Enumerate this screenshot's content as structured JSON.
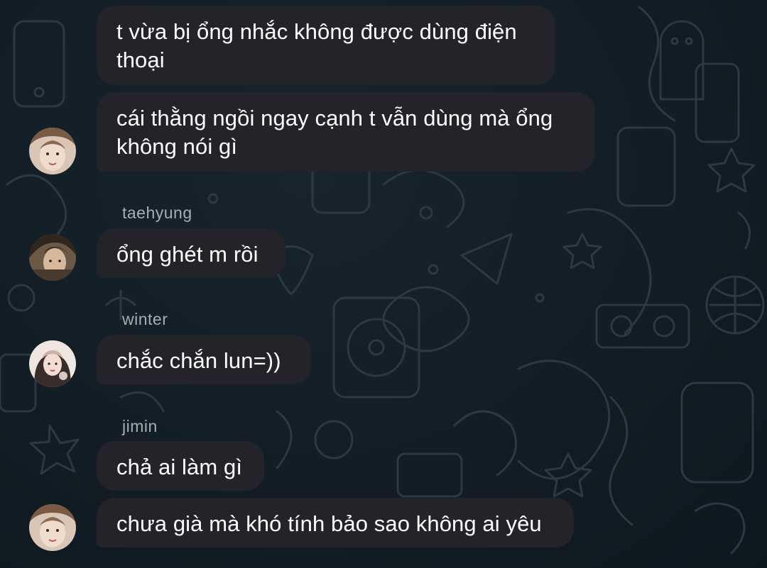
{
  "messages": [
    {
      "text": "t vừa bị ổng nhắc không được dùng điện thoại"
    },
    {
      "text": "cái thằng ngồi ngay cạnh t vẫn dùng mà ổng không nói gì"
    },
    {
      "sender": "taehyung",
      "text": "ổng ghét m rồi"
    },
    {
      "sender": "winter",
      "text": "chắc chắn lun=))"
    },
    {
      "sender": "jimin",
      "text": "chả ai làm gì"
    },
    {
      "text": "chưa già mà khó tính bảo sao không ai yêu"
    }
  ],
  "colors": {
    "background": "#0f1a22",
    "bubble": "#25232a",
    "text": "#ffffff",
    "sender": "#a8adb2"
  },
  "icons": [
    "wallpaper-doodle-pattern"
  ]
}
